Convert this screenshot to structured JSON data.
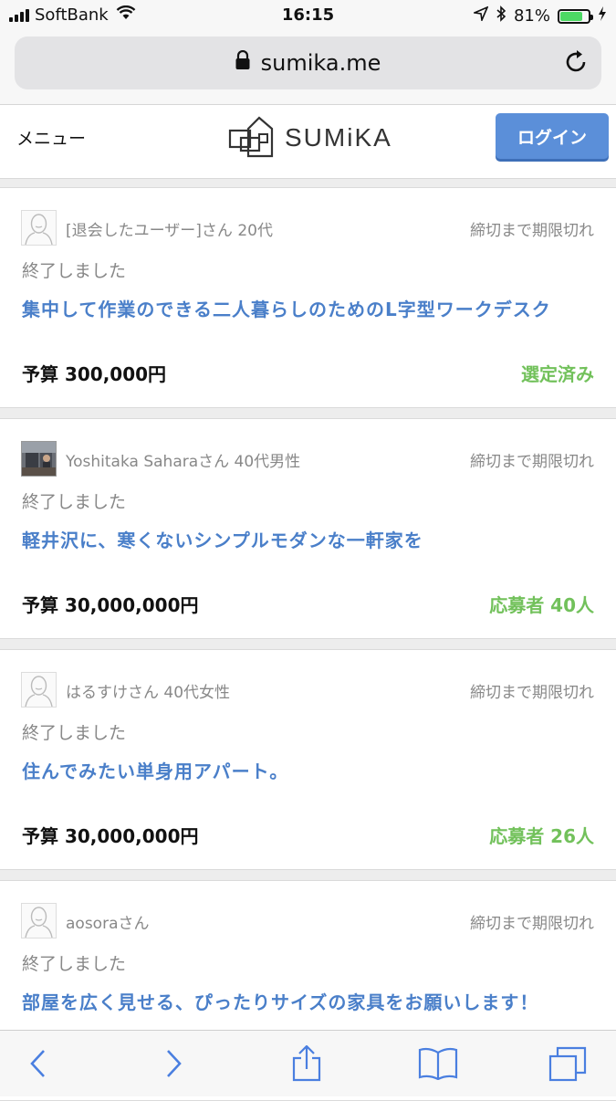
{
  "status_bar": {
    "carrier": "SoftBank",
    "time": "16:15",
    "battery": "81%",
    "battery_level": 0.81
  },
  "browser": {
    "url": "sumika.me"
  },
  "site": {
    "menu_label": "メニュー",
    "logo_text": "SUMiKA",
    "login_label": "ログイン"
  },
  "posts": [
    {
      "user": "[退会したユーザー]さん 20代",
      "deadline": "締切まで期限切れ",
      "status": "終了しました",
      "title": "集中して作業のできる二人暮らしのためのL字型ワークデスク",
      "budget": "予算 300,000円",
      "result": "選定済み"
    },
    {
      "user": "Yoshitaka Saharaさん 40代男性",
      "deadline": "締切まで期限切れ",
      "status": "終了しました",
      "title": "軽井沢に、寒くないシンプルモダンな一軒家を",
      "budget": "予算 30,000,000円",
      "result": "応募者 40人"
    },
    {
      "user": "はるすけさん 40代女性",
      "deadline": "締切まで期限切れ",
      "status": "終了しました",
      "title": "住んでみたい単身用アパート。",
      "budget": "予算 30,000,000円",
      "result": "応募者 26人"
    },
    {
      "user": "aosoraさん",
      "deadline": "締切まで期限切れ",
      "status": "終了しました",
      "title": "部屋を広く見せる、ぴったりサイズの家具をお願いします！",
      "budget": "",
      "result": ""
    }
  ],
  "colors": {
    "accent": "#4a7fc9",
    "login": "#5b8fd9",
    "result_green": "#72c15b"
  }
}
